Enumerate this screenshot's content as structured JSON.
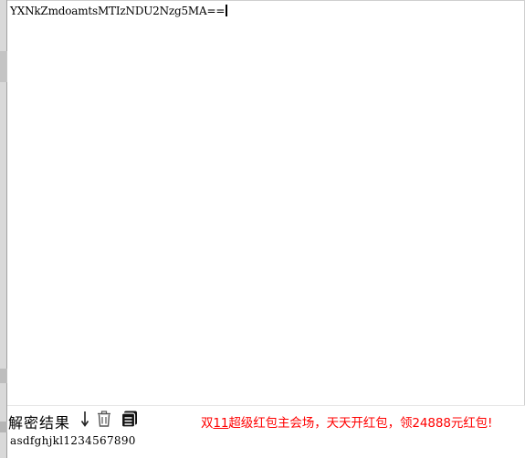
{
  "input": {
    "value": "YXNkZmdoamtsMTIzNDU2Nzg5MA=="
  },
  "toolbar": {
    "result_label": "解密结果",
    "icons": [
      "arrow-down-icon",
      "trash-icon",
      "copy-icon"
    ],
    "promo_prefix": "双",
    "promo_underlined": "11",
    "promo_suffix": "超级红包主会场，天天开红包，领24888元红包!",
    "promo_color": "#ff0000"
  },
  "output": {
    "value": "asdfghjkl1234567890"
  }
}
